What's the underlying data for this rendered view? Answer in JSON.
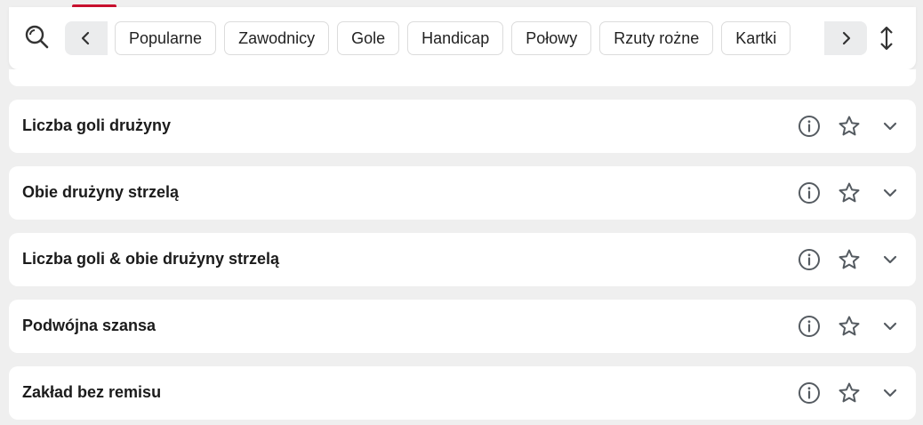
{
  "filters": {
    "chips": [
      "Popularne",
      "Zawodnicy",
      "Gole",
      "Handicap",
      "Połowy",
      "Rzuty rożne",
      "Kartki"
    ]
  },
  "markets": [
    {
      "title": "Liczba goli drużyny"
    },
    {
      "title": "Obie drużyny strzelą"
    },
    {
      "title": "Liczba goli & obie drużyny strzelą"
    },
    {
      "title": "Podwójna szansa"
    },
    {
      "title": "Zakład bez remisu"
    }
  ],
  "colors": {
    "accent": "#c8102e",
    "background": "#efefef",
    "icon": "#555b61"
  },
  "icons": {
    "search": "search-icon",
    "prev": "chevron-left-icon",
    "next": "chevron-right-icon",
    "sort": "sort-vertical-icon",
    "info": "info-icon",
    "favorite": "star-icon",
    "expand": "chevron-down-icon"
  }
}
